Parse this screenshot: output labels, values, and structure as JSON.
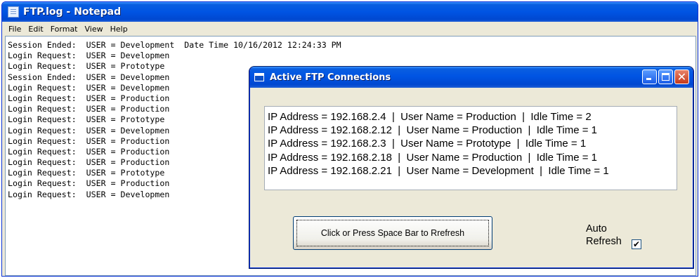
{
  "notepad": {
    "title": "FTP.log - Notepad",
    "menu": [
      "File",
      "Edit",
      "Format",
      "View",
      "Help"
    ],
    "lines": [
      "Session Ended:  USER = Development  Date Time 10/16/2012 12:24:33 PM",
      "Login Request:  USER = Developmen",
      "Login Request:  USER = Prototype",
      "Session Ended:  USER = Developmen",
      "Login Request:  USER = Developmen",
      "Login Request:  USER = Production",
      "Login Request:  USER = Production",
      "Login Request:  USER = Prototype",
      "Login Request:  USER = Developmen",
      "Login Request:  USER = Production",
      "Login Request:  USER = Production",
      "Login Request:  USER = Production",
      "Login Request:  USER = Prototype",
      "Login Request:  USER = Production",
      "Login Request:  USER = Developmen"
    ]
  },
  "dialog": {
    "title": "Active FTP Connections",
    "connections": [
      "IP Address = 192.168.2.4  |  User Name = Production  |  Idle Time = 2",
      "IP Address = 192.168.2.12  |  User Name = Production  |  Idle Time = 1",
      "IP Address = 192.168.2.3  |  User Name = Prototype  |  Idle Time = 1",
      "IP Address = 192.168.2.18  |  User Name = Production  |  Idle Time = 1",
      "IP Address = 192.168.2.21  |  User Name = Development  |  Idle Time = 1"
    ],
    "refresh_button": "Click or Press Space Bar to Rrefresh",
    "auto_refresh_label_1": "Auto",
    "auto_refresh_label_2": "Refresh",
    "auto_refresh_checked": true,
    "close_glyph": "✕"
  },
  "colors": {
    "titlebar": "#0054e3",
    "window_bg": "#ece9d8",
    "close_button": "#c5391a"
  }
}
